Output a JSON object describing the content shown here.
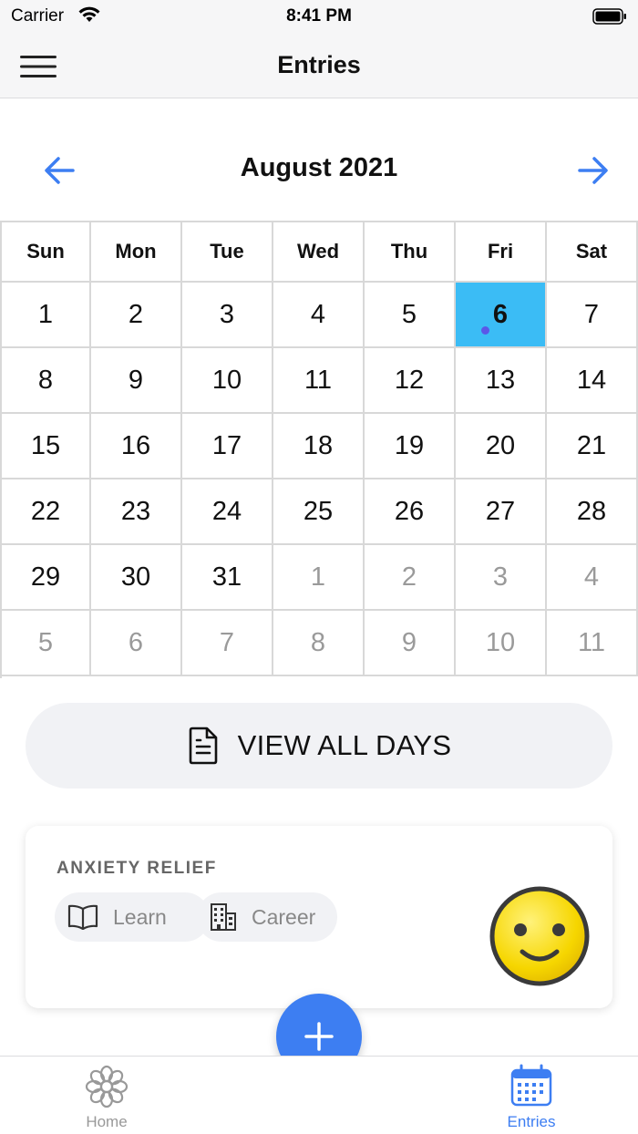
{
  "status_bar": {
    "carrier": "Carrier",
    "time": "8:41 PM"
  },
  "nav": {
    "title": "Entries",
    "menu_icon": "hamburger-icon"
  },
  "calendar": {
    "month_label": "August 2021",
    "weekdays": [
      "Sun",
      "Mon",
      "Tue",
      "Wed",
      "Thu",
      "Fri",
      "Sat"
    ],
    "weeks": [
      [
        "1",
        "2",
        "3",
        "4",
        "5",
        "6",
        "7"
      ],
      [
        "8",
        "9",
        "10",
        "11",
        "12",
        "13",
        "14"
      ],
      [
        "15",
        "16",
        "17",
        "18",
        "19",
        "20",
        "21"
      ],
      [
        "22",
        "23",
        "24",
        "25",
        "26",
        "27",
        "28"
      ],
      [
        "29",
        "30",
        "31",
        "1",
        "2",
        "3",
        "4"
      ],
      [
        "5",
        "6",
        "7",
        "8",
        "9",
        "10",
        "11"
      ]
    ],
    "selected_day": "6",
    "selected_color": "#3bbcf5",
    "entry_dot_color": "#5b57e8"
  },
  "view_all": {
    "label": "VIEW ALL DAYS",
    "icon": "document-icon"
  },
  "entry": {
    "title": "ANXIETY RELIEF",
    "tags": [
      {
        "label": "Learn",
        "icon": "book-icon"
      },
      {
        "label": "Career",
        "icon": "building-icon"
      }
    ],
    "mood_icon": "smiley-face-icon"
  },
  "fab": {
    "icon": "plus-icon",
    "color": "#3d7ef2"
  },
  "tabs": [
    {
      "label": "Home",
      "icon": "flower-icon",
      "active": false
    },
    {
      "label": "Entries",
      "icon": "calendar-icon",
      "active": true
    }
  ],
  "colors": {
    "accent": "#3d7ef2",
    "inactive": "#999999"
  }
}
